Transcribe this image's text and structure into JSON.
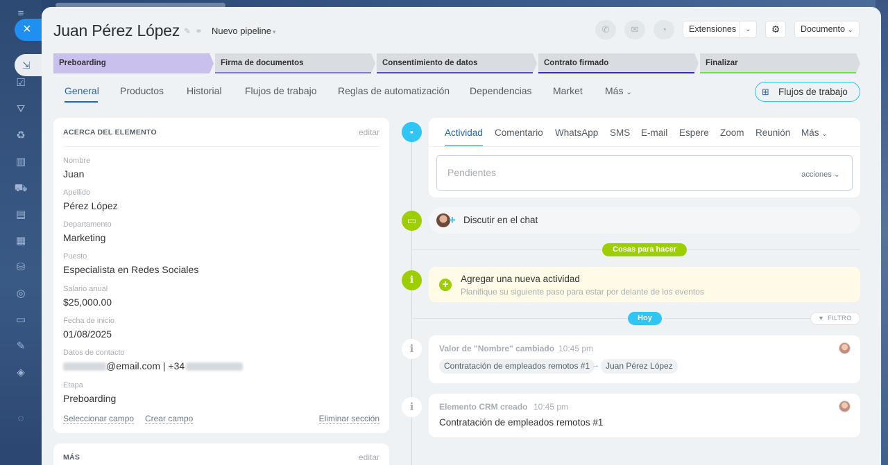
{
  "header": {
    "title": "Juan Pérez López",
    "pipeline": "Nuevo pipeline",
    "extensiones": "Extensiones",
    "documento": "Documento"
  },
  "stages": [
    {
      "label": "Preboarding",
      "bg": "#c9c0ee",
      "bar": ""
    },
    {
      "label": "Firma de documentos",
      "bg": "#d9dde2",
      "bar": "#7e7ec8"
    },
    {
      "label": "Consentimiento de datos",
      "bg": "#d9dde2",
      "bar": "#5c49b8"
    },
    {
      "label": "Contrato firmado",
      "bg": "#d9dde2",
      "bar": "#3c2aa8"
    },
    {
      "label": "Finalizar",
      "bg": "#d9dde2",
      "bar": "#6fdf40"
    }
  ],
  "tabs": [
    "General",
    "Productos",
    "Historial",
    "Flujos de trabajo",
    "Reglas de automatización",
    "Dependencias",
    "Market",
    "Más"
  ],
  "flow_button": "Flujos de trabajo",
  "about": {
    "heading": "ACERCA DEL ELEMENTO",
    "edit": "editar",
    "fields": [
      {
        "label": "Nombre",
        "value": "Juan"
      },
      {
        "label": "Apellido",
        "value": "Pérez López"
      },
      {
        "label": "Departamento",
        "value": "Marketing"
      },
      {
        "label": "Puesto",
        "value": "Especialista en Redes Sociales"
      },
      {
        "label": "Salario anual",
        "value": "$25,000.00"
      },
      {
        "label": "Fecha de inicio",
        "value": "01/08/2025"
      },
      {
        "label": "Datos de contacto",
        "value": "@email.com | +34"
      },
      {
        "label": "Etapa",
        "value": "Preboarding"
      }
    ],
    "select_field": "Seleccionar campo",
    "create_field": "Crear campo",
    "delete_section": "Eliminar sección"
  },
  "more": {
    "heading": "MÁS",
    "edit": "editar"
  },
  "activity": {
    "tabs": [
      "Actividad",
      "Comentario",
      "WhatsApp",
      "SMS",
      "E-mail",
      "Espere",
      "Zoom",
      "Reunión",
      "Más"
    ],
    "placeholder": "Pendientes",
    "actions": "acciones"
  },
  "chat": {
    "label": "Discutir en el chat"
  },
  "todo_pill": "Cosas para hacer",
  "add_activity": {
    "title": "Agregar una nueva actividad",
    "subtitle": "Planifique su siguiente paso para estar por delante de los eventos"
  },
  "today_pill": "Hoy",
  "filter": "FILTRO",
  "history": [
    {
      "title": "Valor de \"Nombre\" cambiado",
      "time": "10:45 pm",
      "from": "Contratación de empleados remotos #1",
      "to": "Juan Pérez López"
    },
    {
      "title": "Elemento CRM creado",
      "time": "10:45 pm",
      "text": "Contratación de empleados remotos #1"
    }
  ],
  "colors": {
    "accent": "#2067b0",
    "green": "#9dcf00",
    "cyan": "#2fc6f6"
  }
}
